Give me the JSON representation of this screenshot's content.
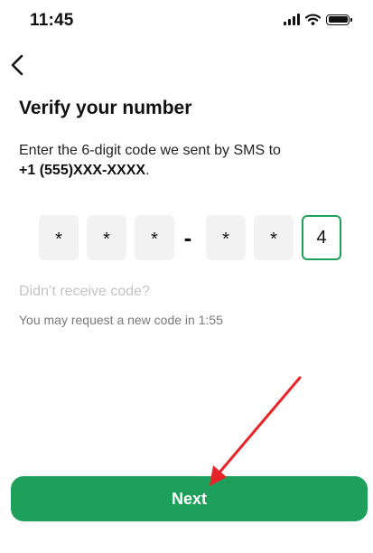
{
  "status_bar": {
    "time": "11:45",
    "icons": [
      "signal-icon",
      "wifi-icon",
      "battery-icon"
    ]
  },
  "nav": {
    "back_icon": "chevron-left-icon"
  },
  "title": "Verify your number",
  "instruction": {
    "text": "Enter the 6-digit code we sent by SMS to",
    "phone": "+1 (555)XXX-XXXX",
    "suffix": "."
  },
  "code": {
    "digits": [
      "*",
      "*",
      "*",
      "*",
      "*",
      "4"
    ],
    "separator": "-",
    "active_index": 5
  },
  "resend_link": "Didn’t receive code?",
  "timer_text": "You may request a new code in 1:55",
  "next_button": "Next",
  "colors": {
    "accent": "#1ea05a",
    "annotation": "#e8242b",
    "box_bg": "#f2f2f2"
  }
}
